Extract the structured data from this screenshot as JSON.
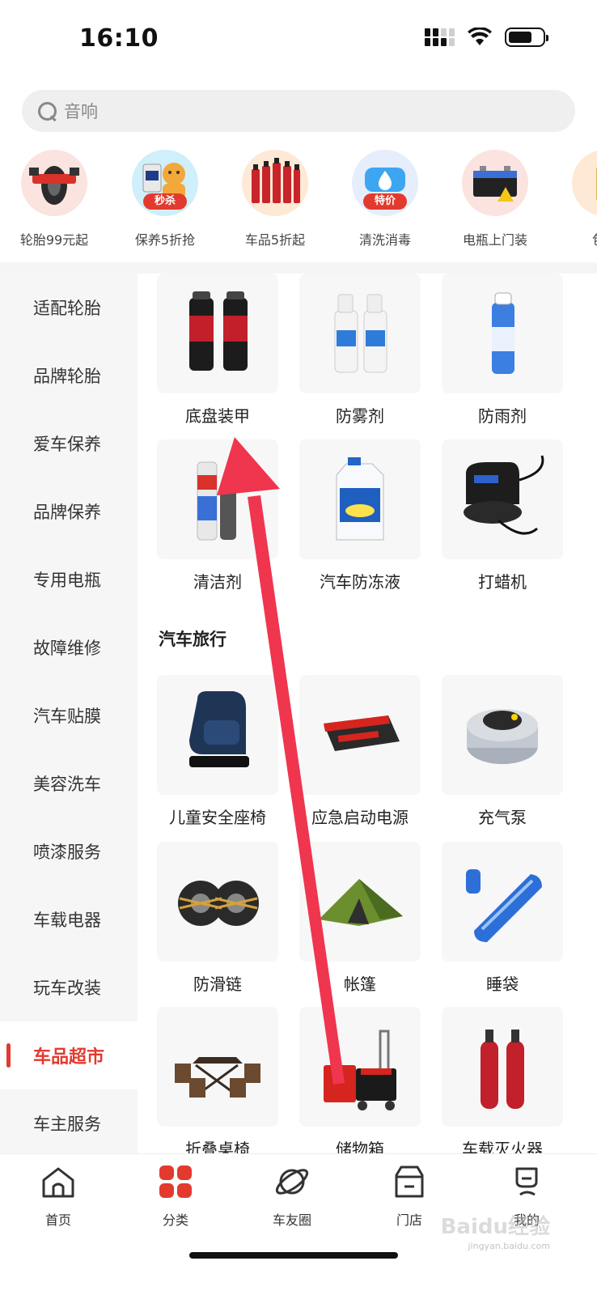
{
  "status_bar": {
    "time": "16:10"
  },
  "search": {
    "placeholder": "音响"
  },
  "promos": [
    {
      "label": "轮胎99元起",
      "badge": ""
    },
    {
      "label": "保养5折抢",
      "badge": "秒杀"
    },
    {
      "label": "车品5折起",
      "badge": ""
    },
    {
      "label": "清洗消毒",
      "badge": "特价"
    },
    {
      "label": "电瓶上门装",
      "badge": ""
    },
    {
      "label": "包年",
      "badge": ""
    }
  ],
  "sidebar": {
    "items": [
      {
        "label": "适配轮胎"
      },
      {
        "label": "品牌轮胎"
      },
      {
        "label": "爱车保养"
      },
      {
        "label": "品牌保养"
      },
      {
        "label": "专用电瓶"
      },
      {
        "label": "故障维修"
      },
      {
        "label": "汽车贴膜"
      },
      {
        "label": "美容洗车"
      },
      {
        "label": "喷漆服务"
      },
      {
        "label": "车载电器"
      },
      {
        "label": "玩车改装"
      },
      {
        "label": "车品超市"
      },
      {
        "label": "车主服务"
      }
    ],
    "active_index": 11
  },
  "content": {
    "products_top": [
      {
        "name": "底盘装甲",
        "icon": "chassis-armor-spray"
      },
      {
        "name": "防雾剂",
        "icon": "anti-fog-spray"
      },
      {
        "name": "防雨剂",
        "icon": "rain-repellent-spray"
      },
      {
        "name": "清洁剂",
        "icon": "cleaner-spray"
      },
      {
        "name": "汽车防冻液",
        "icon": "antifreeze-bottle"
      },
      {
        "name": "打蜡机",
        "icon": "polisher"
      }
    ],
    "section_title": "汽车旅行",
    "products_travel": [
      {
        "name": "儿童安全座椅",
        "icon": "child-seat"
      },
      {
        "name": "应急启动电源",
        "icon": "jump-starter"
      },
      {
        "name": "充气泵",
        "icon": "air-pump"
      },
      {
        "name": "防滑链",
        "icon": "snow-chains"
      },
      {
        "name": "帐篷",
        "icon": "tent"
      },
      {
        "name": "睡袋",
        "icon": "sleeping-bag"
      },
      {
        "name": "折叠桌椅",
        "icon": "folding-table"
      },
      {
        "name": "储物箱",
        "icon": "storage-cart"
      },
      {
        "name": "车载灭火器",
        "icon": "fire-extinguisher"
      }
    ]
  },
  "tabs": [
    {
      "label": "首页",
      "icon": "home-icon"
    },
    {
      "label": "分类",
      "icon": "category-icon"
    },
    {
      "label": "车友圈",
      "icon": "planet-icon"
    },
    {
      "label": "门店",
      "icon": "store-icon"
    },
    {
      "label": "我的",
      "icon": "profile-icon"
    }
  ],
  "watermark": {
    "text": "Baidu经验",
    "sub": "jingyan.baidu.com"
  },
  "colors": {
    "accent": "#e33a2f",
    "annotation_arrow": "#f0354f"
  }
}
